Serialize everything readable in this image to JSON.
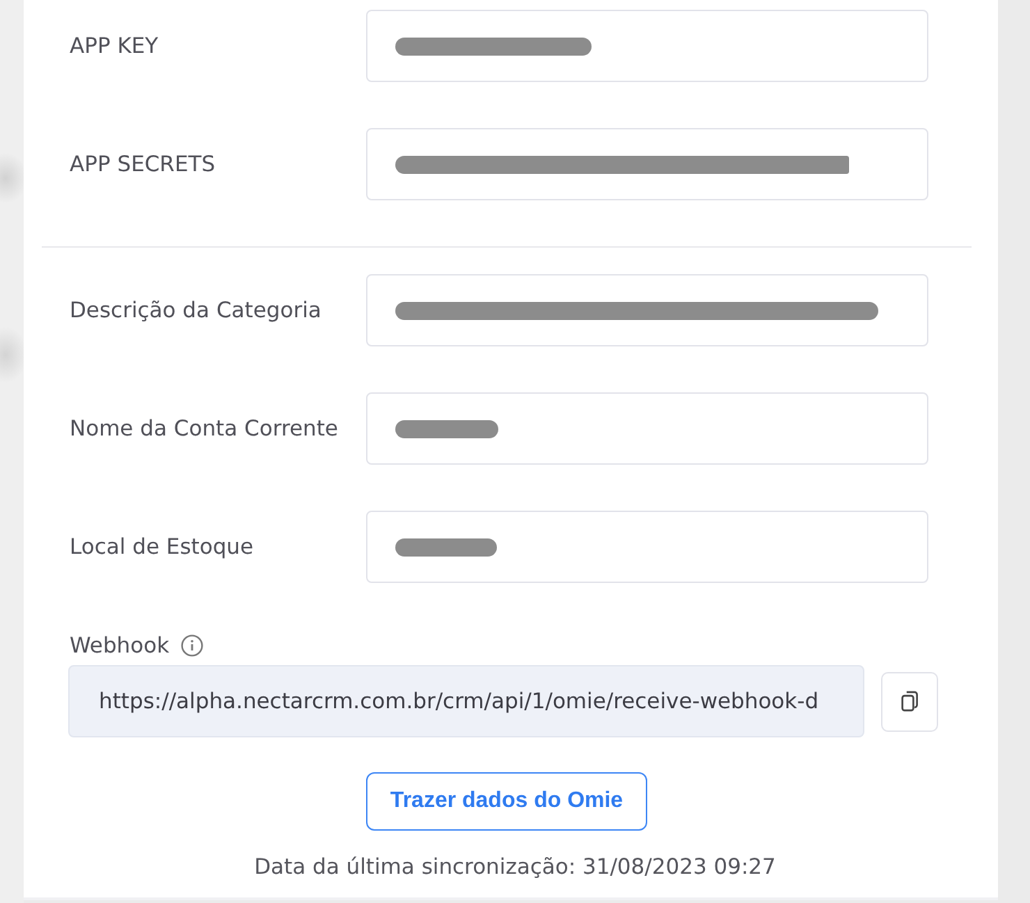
{
  "credentials": [
    {
      "label": "APP KEY",
      "redacted": true
    },
    {
      "label": "APP SECRETS",
      "redacted": true
    }
  ],
  "mappings": [
    {
      "label": "Descrição da Categoria",
      "redacted": true
    },
    {
      "label": "Nome da Conta Corrente",
      "redacted": true
    },
    {
      "label": "Local de Estoque",
      "redacted": true
    }
  ],
  "webhook": {
    "label": "Webhook",
    "value": "https://alpha.nectarcrm.com.br/crm/api/1/omie/receive-webhook-d"
  },
  "fetch_button": {
    "label": "Trazer dados do Omie"
  },
  "last_sync": "Data da última sincronização: 31/08/2023 09:27"
}
